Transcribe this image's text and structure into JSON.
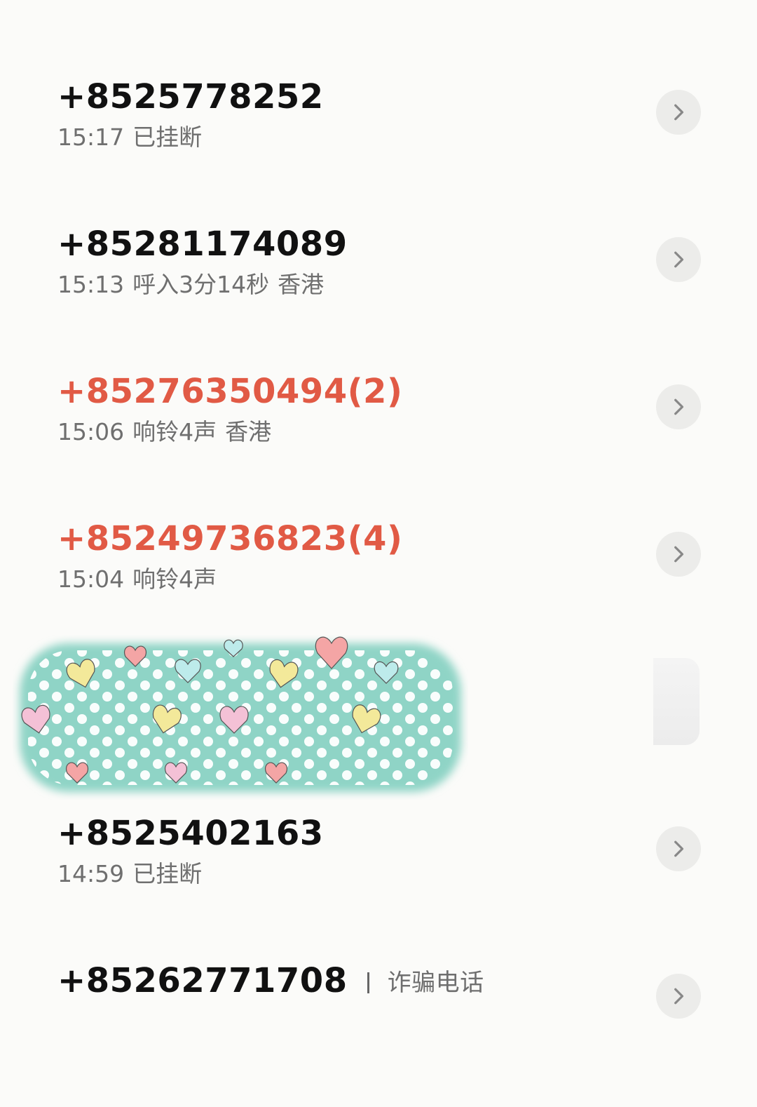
{
  "calls": [
    {
      "number": "+8525778252",
      "missed": false,
      "time": "15:17",
      "status": "已挂断",
      "location": ""
    },
    {
      "number": "+85281174089",
      "missed": false,
      "time": "15:13",
      "status": "呼入3分14秒",
      "location": "香港"
    },
    {
      "number": "+85276350494(2)",
      "missed": true,
      "time": "15:06",
      "status": "响铃4声",
      "location": "香港"
    },
    {
      "number": "+85249736823(4)",
      "missed": true,
      "time": "15:04",
      "status": "响铃4声",
      "location": ""
    },
    {
      "number": "+8525402163",
      "missed": false,
      "time": "14:59",
      "status": "已挂断",
      "location": ""
    },
    {
      "number": "+85262771708",
      "missed": false,
      "tag": "诈骗电话"
    }
  ],
  "icons": {
    "info": "chevron-right-icon",
    "sticker": "polka-dot-heart-sticker"
  },
  "colors": {
    "missed": "#e15a45",
    "normal": "#111111",
    "detail": "#6f6f6f",
    "button_bg": "#ececea",
    "sticker_bg": "#8fd4c6"
  }
}
